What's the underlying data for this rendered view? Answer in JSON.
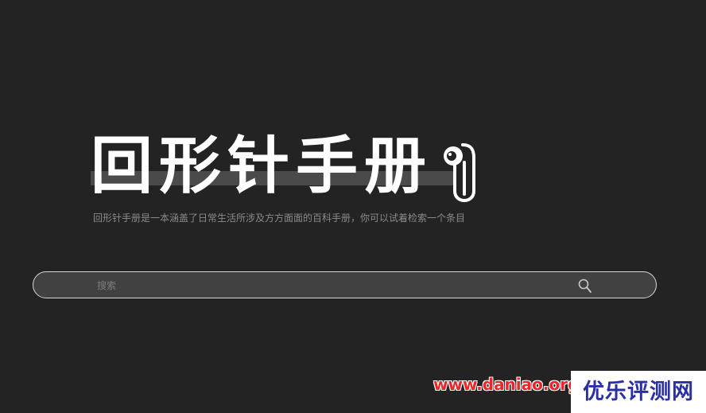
{
  "logo": {
    "title": "回形针手册",
    "icon": "paperclip-mascot-icon"
  },
  "tagline": "回形针手册是一本涵盖了日常生活所涉及方方面面的百科手册，你可以试着检索一个条目",
  "search": {
    "placeholder": "搜索",
    "icon": "search-icon"
  },
  "watermark": {
    "url": "www.daniao.org",
    "badge": "优乐评测网",
    "url_color": "#e8262b",
    "badge_color": "#2a2fa8"
  },
  "colors": {
    "background": "#232323",
    "search_background": "#414141",
    "logo_bar": "#4a4a4a"
  }
}
